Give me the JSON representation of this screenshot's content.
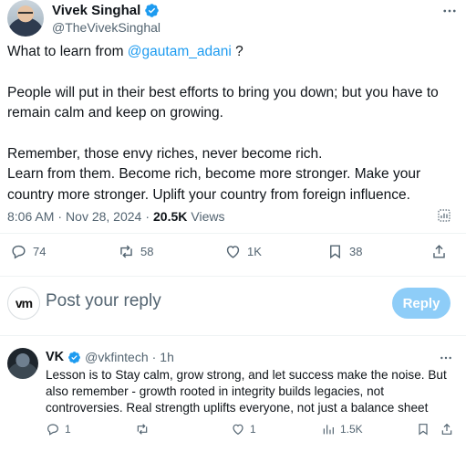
{
  "main_tweet": {
    "display_name": "Vivek Singhal",
    "handle": "@TheVivekSinghal",
    "text": {
      "line1_prefix": "What to learn from ",
      "line1_mention": "@gautam_adani",
      "line1_suffix": " ?",
      "para2": "People will put in their best efforts to bring you down; but you have to remain calm and keep on growing.",
      "para3_line1": "Remember, those envy riches, never become rich.",
      "para3_line2": "Learn from them. Become rich, become more stronger. Make your country more stronger. Uplift your country from foreign influence."
    },
    "time": "8:06 AM",
    "date": "Nov 28, 2024",
    "views_count": "20.5K",
    "views_label": "Views",
    "actions": {
      "replies": "74",
      "reposts": "58",
      "likes": "1K",
      "bookmarks": "38"
    }
  },
  "reply_composer": {
    "avatar_text": "vm",
    "placeholder": "Post your reply",
    "button_label": "Reply"
  },
  "reply_tweet": {
    "display_name": "VK",
    "handle": "@vkfintech",
    "separator": "·",
    "time": "1h",
    "text": "Lesson is to Stay calm, grow strong, and let success make the noise. But also remember - growth rooted in integrity builds legacies, not controversies. Real strength uplifts everyone, not just a balance sheet",
    "actions": {
      "replies": "1",
      "reposts": "",
      "likes": "1",
      "views": "1.5K"
    }
  },
  "colors": {
    "accent": "#1d9bf0",
    "secondary_text": "#536471",
    "reply_button_disabled": "#8ecdf8"
  },
  "icons": [
    "more-icon",
    "verified-icon",
    "analytics-icon",
    "reply-icon",
    "repost-icon",
    "like-icon",
    "bookmark-icon",
    "share-icon",
    "views-icon"
  ]
}
